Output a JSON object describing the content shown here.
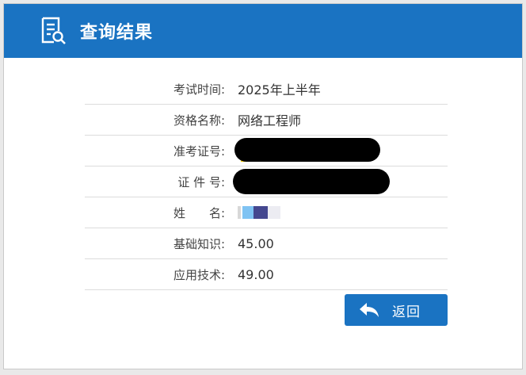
{
  "header": {
    "title": "查询结果",
    "icon": "document-search-icon",
    "color": "#1a73c2"
  },
  "rows": [
    {
      "label": "考试时间:",
      "value": "2025年上半年"
    },
    {
      "label": "资格名称:",
      "value": "网络工程师"
    },
    {
      "label": "准考证号:",
      "value": ""
    },
    {
      "label": "证 件 号:",
      "value": ""
    },
    {
      "label": "姓　　名:",
      "value": ""
    },
    {
      "label": "基础知识:",
      "value": "45.00"
    },
    {
      "label": "应用技术:",
      "value": "49.00"
    }
  ],
  "back_button": {
    "label": "返回",
    "icon": "reply-arrow-icon"
  }
}
